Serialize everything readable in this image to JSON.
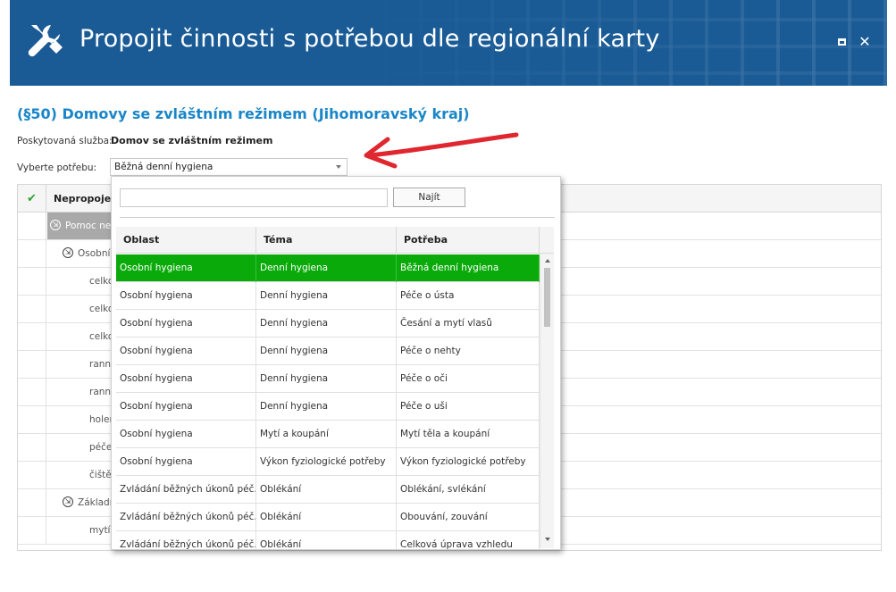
{
  "window": {
    "title": "Propojit činnosti s potřebou dle regionální karty",
    "icon": "tools-icon",
    "controls": {
      "maximize": "maximize-icon",
      "close": "✕"
    }
  },
  "heading": "(§50) Domovy se zvláštním režimem (Jihomoravský kraj)",
  "service": {
    "label": "Poskytovaná služba:",
    "value": "Domov se zvláštním režimem"
  },
  "need": {
    "label": "Vyberte potřebu:",
    "selected": "Běžná denní hygiena"
  },
  "main_grid": {
    "header_label": "Nepropojen",
    "rows": [
      {
        "text": "Pomoc neb",
        "kind": "group-selected"
      },
      {
        "text": "Osobní h",
        "kind": "subgroup"
      },
      {
        "text": "celkov",
        "kind": "item"
      },
      {
        "text": "celkov",
        "kind": "item"
      },
      {
        "text": "celkov",
        "kind": "item"
      },
      {
        "text": "ranní",
        "kind": "item"
      },
      {
        "text": "ranní",
        "kind": "item"
      },
      {
        "text": "holen",
        "kind": "item"
      },
      {
        "text": "péče",
        "kind": "item"
      },
      {
        "text": "čištěn",
        "kind": "item"
      },
      {
        "text": "Základní",
        "kind": "subgroup"
      },
      {
        "text": "mytí v",
        "kind": "item"
      }
    ]
  },
  "dropdown": {
    "search_value": "",
    "find_label": "Najít",
    "columns": [
      "Oblast",
      "Téma",
      "Potřeba"
    ],
    "rows": [
      [
        "Osobní hygiena",
        "Denní hygiena",
        "Běžná denní hygiena"
      ],
      [
        "Osobní hygiena",
        "Denní hygiena",
        "Péče o ústa"
      ],
      [
        "Osobní hygiena",
        "Denní hygiena",
        "Česání a mytí vlasů"
      ],
      [
        "Osobní hygiena",
        "Denní hygiena",
        "Péče o nehty"
      ],
      [
        "Osobní hygiena",
        "Denní hygiena",
        "Péče o oči"
      ],
      [
        "Osobní hygiena",
        "Denní hygiena",
        "Péče o uši"
      ],
      [
        "Osobní hygiena",
        "Mytí a koupání",
        "Mytí těla a koupání"
      ],
      [
        "Osobní hygiena",
        "Výkon fyziologické potřeby",
        "Výkon fyziologické potřeby"
      ],
      [
        "Zvládání běžných úkonů péč...",
        "Oblékání",
        "Oblékání, svlékání"
      ],
      [
        "Zvládání běžných úkonů péč...",
        "Oblékání",
        "Obouvání, zouvání"
      ],
      [
        "Zvládání běžných úkonů péč...",
        "Oblékání",
        "Celková úprava vzhledu"
      ]
    ],
    "selected_index": 0,
    "selected_color": "#0aaa0a"
  },
  "colors": {
    "titlebar": "#1a5b96",
    "heading": "#1a86c8",
    "annotation_arrow": "#e0262e"
  }
}
